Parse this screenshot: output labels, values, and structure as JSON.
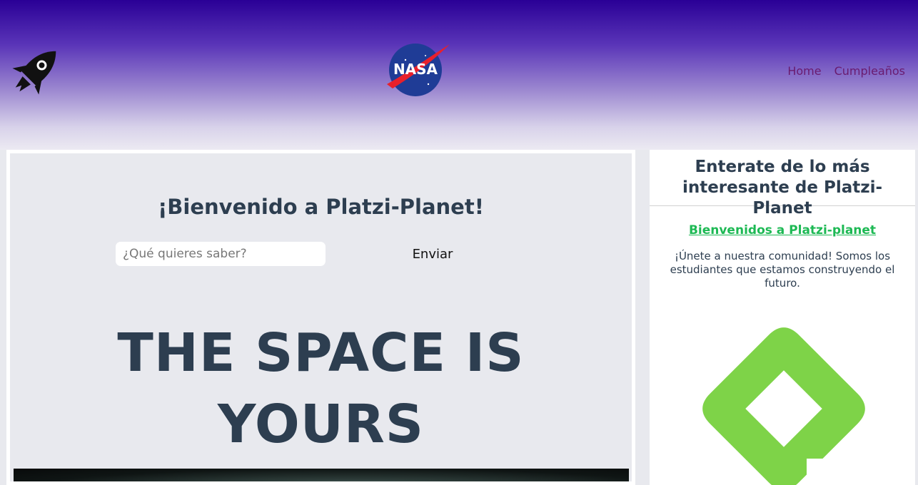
{
  "header": {
    "nav": [
      {
        "label": "Home"
      },
      {
        "label": "Cumpleaños"
      }
    ],
    "logo_left_icon": "rocket-icon",
    "logo_center_icon": "nasa-logo",
    "nasa_text": "NASA"
  },
  "main": {
    "welcome": "¡Bienvenido a Platzi-Planet!",
    "search": {
      "placeholder": "¿Qué quieres saber?",
      "value": ""
    },
    "send_label": "Enviar",
    "hero_line1": "THE SPACE IS",
    "hero_line2": "YOURS"
  },
  "sidebar": {
    "title": "Enterate de lo más interesante de Platzi-Planet",
    "link": "Bienvenidos a Platzi-planet",
    "text": "¡Únete a nuestra comunidad! Somos los estudiantes que estamos construyendo el futuro.",
    "logo_icon": "platzi-logo"
  },
  "colors": {
    "header_top": "#2a0096",
    "nav_link": "#6a1b6f",
    "heading": "#2d3e50",
    "sidebar_link": "#1db954",
    "platzi_green": "#7ed348"
  }
}
